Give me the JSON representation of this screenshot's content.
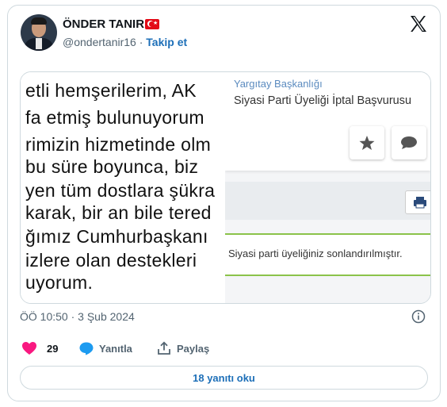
{
  "author": {
    "name": "ÖNDER TANIR",
    "handle": "@ondertanir16",
    "separator": "·",
    "follow_label": "Takip et"
  },
  "media": {
    "text_lines": [
      "etli hemşerilerim, AK",
      "fa etmiş bulunuyorum",
      "rimizin hizmetinde olm",
      " bu süre boyunca, biz",
      "yen tüm dostlara şükra",
      "karak, bir an bile tered",
      "ğımız Cumhurbaşkanı",
      "izlere olan destekleri",
      "uyorum."
    ],
    "panel_subtitle": "Yargıtay Başkanlığı",
    "panel_title": "Siyasi Parti Üyeliği İptal Başvurusu",
    "success_message": "Siyasi parti üyeliğiniz sonlandırılmıştır."
  },
  "timestamp": "ÖÖ 10:50 · 3 Şub 2024",
  "actions": {
    "like_count": "29",
    "reply_label": "Yanıtla",
    "share_label": "Paylaş"
  },
  "read_replies_label": "18 yanıtı oku",
  "colors": {
    "link": "#1d6fb8",
    "like": "#f91880",
    "reply_icon": "#1d9bf0",
    "success_border": "#8bc34a"
  }
}
